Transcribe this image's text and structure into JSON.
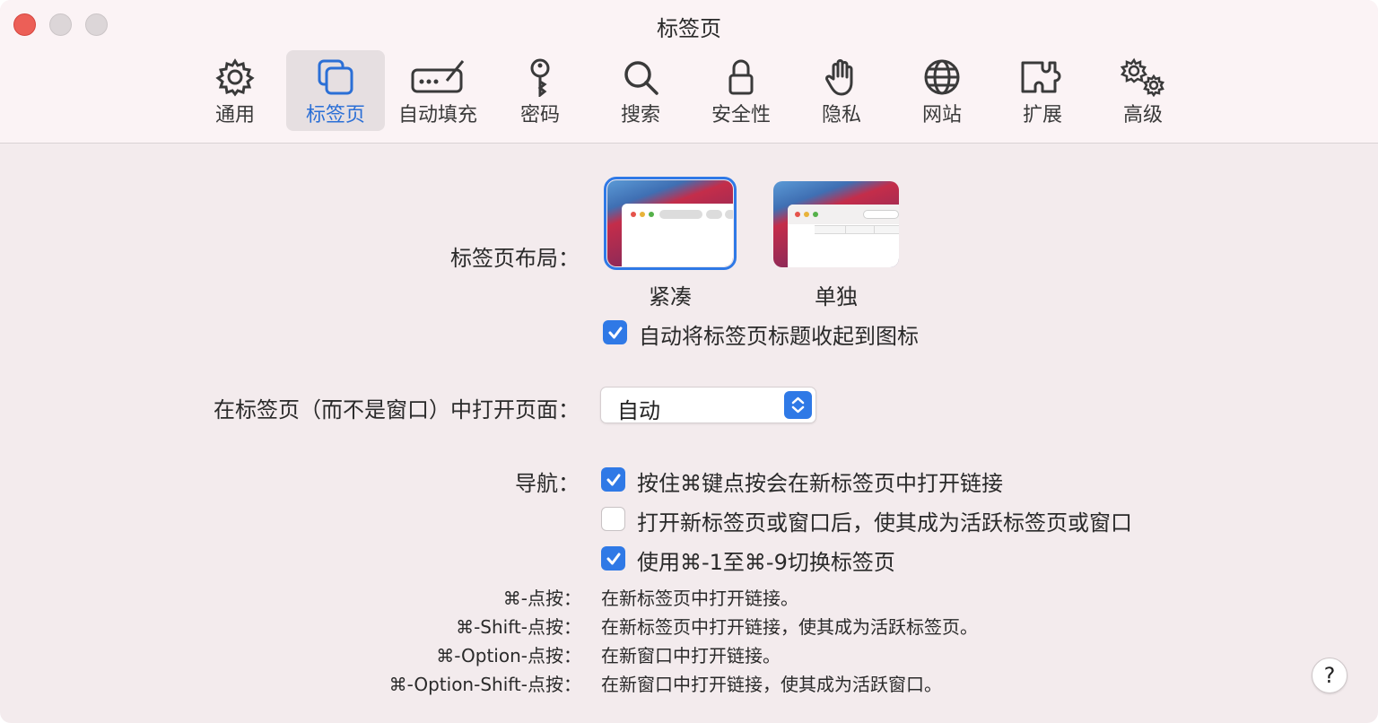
{
  "window": {
    "title": "标签页"
  },
  "toolbar": {
    "items": [
      {
        "label": "通用",
        "icon": "gear-icon"
      },
      {
        "label": "标签页",
        "icon": "tabs-icon",
        "active": true
      },
      {
        "label": "自动填充",
        "icon": "autofill-icon"
      },
      {
        "label": "密码",
        "icon": "key-icon"
      },
      {
        "label": "搜索",
        "icon": "search-icon"
      },
      {
        "label": "安全性",
        "icon": "lock-icon"
      },
      {
        "label": "隐私",
        "icon": "hand-icon"
      },
      {
        "label": "网站",
        "icon": "globe-icon"
      },
      {
        "label": "扩展",
        "icon": "puzzle-icon"
      },
      {
        "label": "高级",
        "icon": "gears-icon"
      }
    ]
  },
  "layout": {
    "label": "标签页布局：",
    "options": [
      {
        "label": "紧凑",
        "selected": true
      },
      {
        "label": "单独",
        "selected": false
      }
    ],
    "collapse_titles": {
      "label": "自动将标签页标题收起到图标",
      "checked": true
    }
  },
  "open_in_tabs": {
    "label": "在标签页（而不是窗口）中打开页面：",
    "value": "自动"
  },
  "navigation": {
    "label": "导航：",
    "options": [
      {
        "label": "按住⌘键点按会在新标签页中打开链接",
        "checked": true
      },
      {
        "label": "打开新标签页或窗口后，使其成为活跃标签页或窗口",
        "checked": false
      },
      {
        "label": "使用⌘-1至⌘-9切换标签页",
        "checked": true
      }
    ]
  },
  "hints": [
    {
      "key": "⌘-点按：",
      "desc": "在新标签页中打开链接。"
    },
    {
      "key": "⌘-Shift-点按：",
      "desc": "在新标签页中打开链接，使其成为活跃标签页。"
    },
    {
      "key": "⌘-Option-点按：",
      "desc": "在新窗口中打开链接。"
    },
    {
      "key": "⌘-Option-Shift-点按：",
      "desc": "在新窗口中打开链接，使其成为活跃窗口。"
    }
  ],
  "help": {
    "label": "?"
  },
  "colors": {
    "accent": "#2f79e6",
    "background": "#f3ebed",
    "close": "#ec5f57"
  }
}
